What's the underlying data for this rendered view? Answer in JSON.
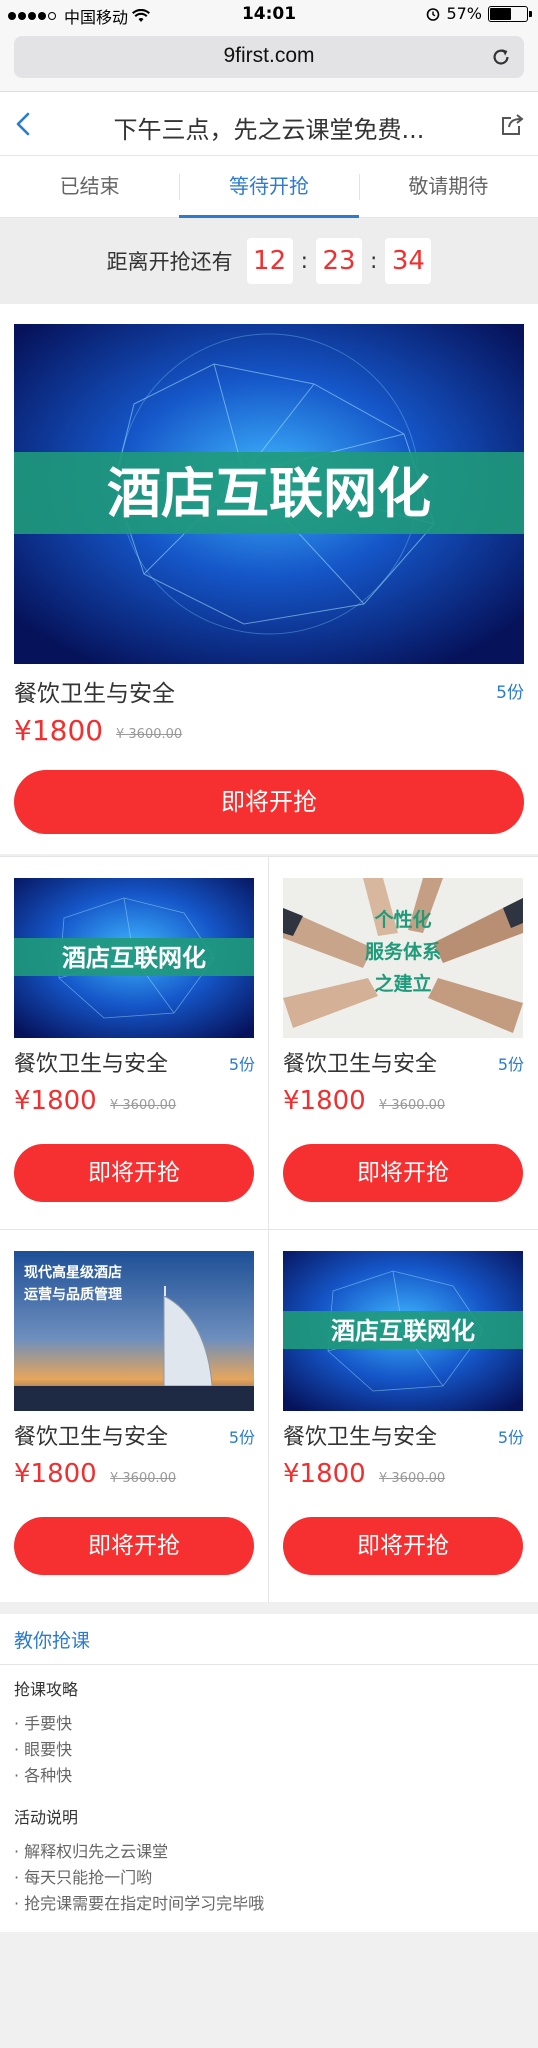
{
  "status": {
    "carrier": "中国移动",
    "time": "14:01",
    "battery": "57%",
    "battery_level": 0.57
  },
  "browser": {
    "url": "9first.com"
  },
  "header": {
    "title": "下午三点，先之云课堂免费..."
  },
  "tabs": [
    {
      "label": "已结束",
      "active": false
    },
    {
      "label": "等待开抢",
      "active": true
    },
    {
      "label": "敬请期待",
      "active": false
    }
  ],
  "countdown": {
    "label": "距离开抢还有",
    "h": "12",
    "m": "23",
    "s": "34",
    "sep": ":"
  },
  "featured": {
    "banner_text": "酒店互联网化",
    "title": "餐饮卫生与安全",
    "count": "5份",
    "price": "¥1800",
    "original": "¥ 3600.00",
    "button": "即将开抢"
  },
  "items": [
    {
      "banner_text": "酒店互联网化",
      "title": "餐饮卫生与安全",
      "count": "5份",
      "price": "¥1800",
      "original": "¥ 3600.00",
      "button": "即将开抢"
    },
    {
      "banner_text": "个性化 服务体系 之建立",
      "banner_line1": "个性化",
      "banner_line2": "服务体系",
      "banner_line3": "之建立",
      "title": "餐饮卫生与安全",
      "count": "5份",
      "price": "¥1800",
      "original": "¥ 3600.00",
      "button": "即将开抢"
    },
    {
      "banner_line1": "现代高星级酒店",
      "banner_line2": "运营与品质管理",
      "title": "餐饮卫生与安全",
      "count": "5份",
      "price": "¥1800",
      "original": "¥ 3600.00",
      "button": "即将开抢"
    },
    {
      "banner_text": "酒店互联网化",
      "title": "餐饮卫生与安全",
      "count": "5份",
      "price": "¥1800",
      "original": "¥ 3600.00",
      "button": "即将开抢"
    }
  ],
  "guide": {
    "title": "教你抢课",
    "strategy_heading": "抢课攻略",
    "strategy": [
      "· 手要快",
      "· 眼要快",
      "· 各种快"
    ],
    "rules_heading": "活动说明",
    "rules": [
      "· 解释权归先之云课堂",
      "· 每天只能抢一门哟",
      "· 抢完课需要在指定时间学习完毕哦"
    ]
  },
  "colors": {
    "accent_blue": "#2b7bd1",
    "accent_red": "#f63030",
    "banner_green": "#1f9a7a"
  }
}
